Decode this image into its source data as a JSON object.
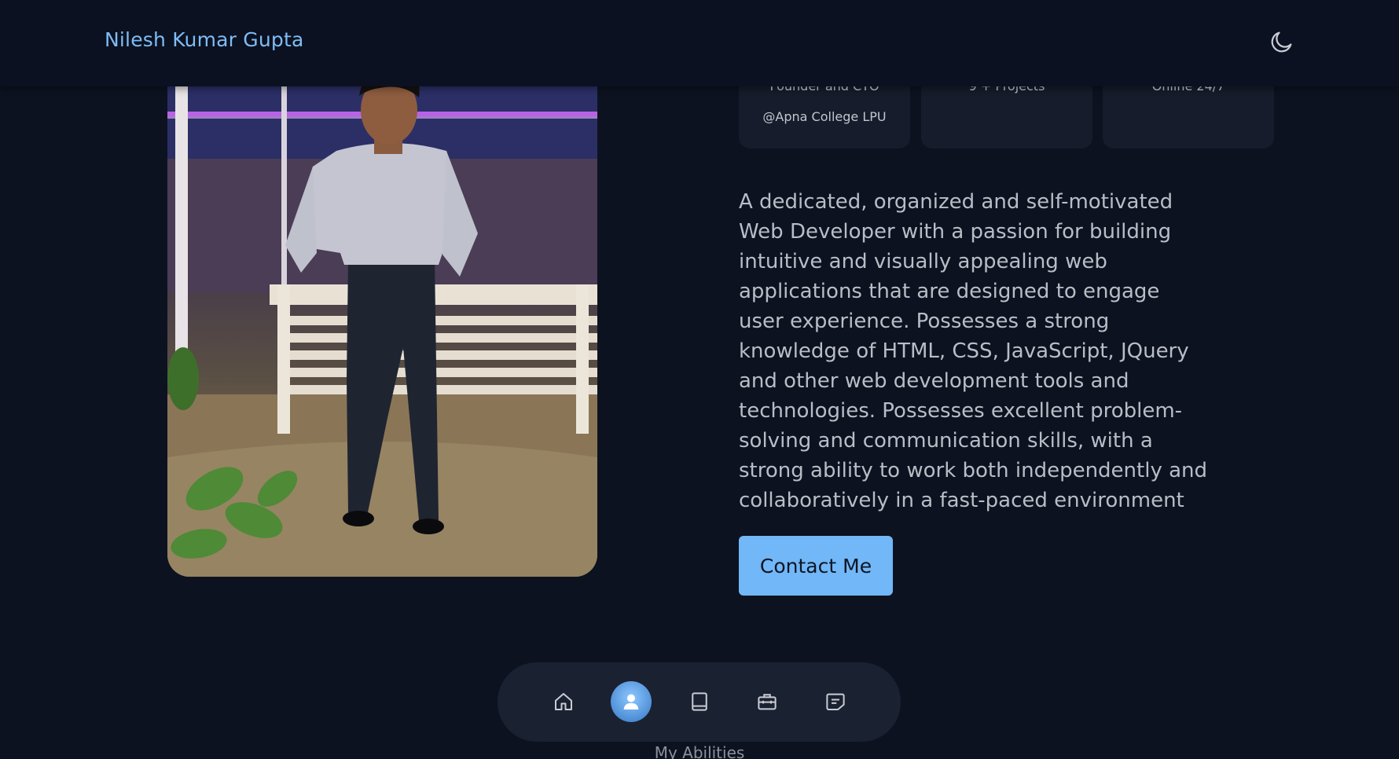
{
  "header": {
    "brand": "Nilesh Kumar Gupta",
    "theme_toggle_icon": "moon-icon"
  },
  "stats": [
    {
      "line1": "Founder and CTO",
      "line2": "@Apna College LPU"
    },
    {
      "line1": "9 + Projects",
      "line2": ""
    },
    {
      "line1": "Online 24/7",
      "line2": ""
    }
  ],
  "about": {
    "photo_icon": "profile-photo",
    "bio": "A dedicated, organized and self-motivated Web Developer with a passion for building intuitive and visually appealing web applications that are designed to engage user experience. Possesses a strong knowledge of HTML, CSS, JavaScript, JQuery and other web development tools and technologies. Possesses excellent problem-solving and communication skills, with a strong ability to work both independently and collaboratively in a fast-paced environment",
    "contact_label": "Contact Me"
  },
  "nav": {
    "items": [
      {
        "icon": "home-icon",
        "active": false
      },
      {
        "icon": "user-icon",
        "active": true
      },
      {
        "icon": "book-icon",
        "active": false
      },
      {
        "icon": "briefcase-icon",
        "active": false
      },
      {
        "icon": "message-icon",
        "active": false
      }
    ]
  },
  "next_section": {
    "label": "My Abilities"
  },
  "colors": {
    "background": "#0d1220",
    "accent": "#72b7f7",
    "brand": "#7fbcf5",
    "card": "#161c2b"
  }
}
